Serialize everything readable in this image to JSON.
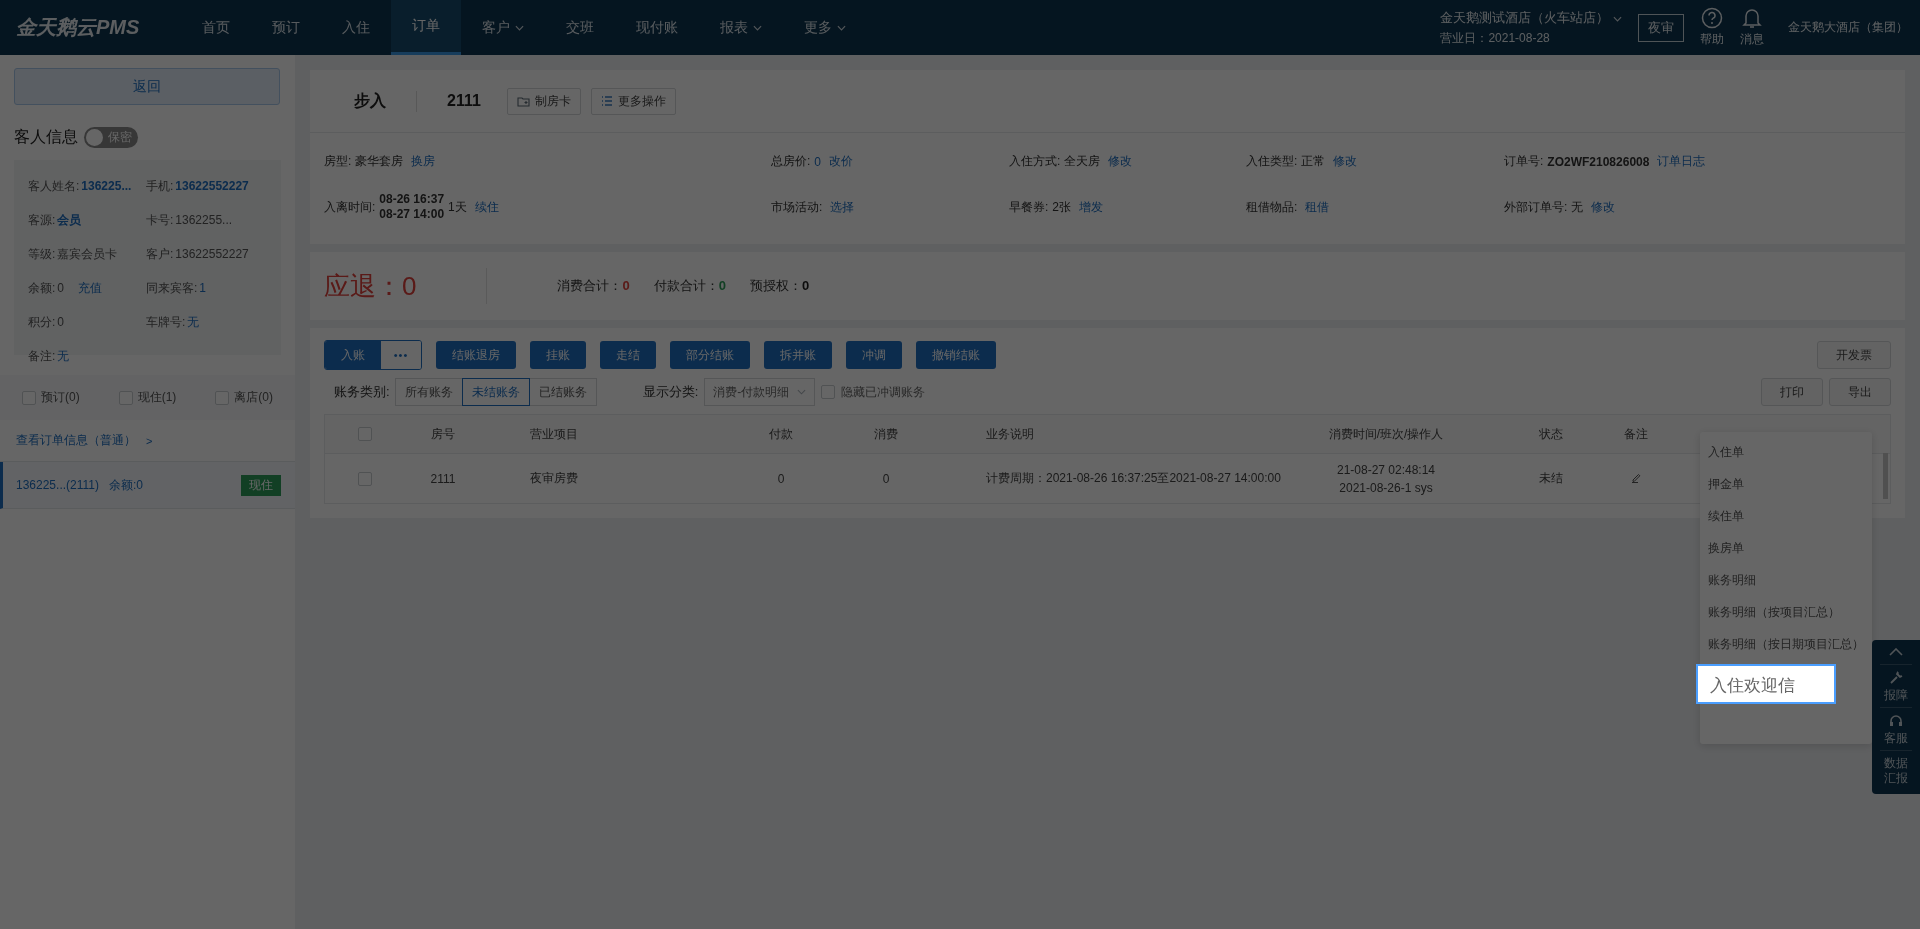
{
  "top_bar": {
    "logo": "金天鹅云PMS",
    "nav": [
      {
        "label": "首页",
        "selected": false,
        "dropdown": false
      },
      {
        "label": "预订",
        "selected": false,
        "dropdown": false
      },
      {
        "label": "入住",
        "selected": false,
        "dropdown": false
      },
      {
        "label": "订单",
        "selected": true,
        "dropdown": false
      },
      {
        "label": "客户",
        "selected": false,
        "dropdown": true
      },
      {
        "label": "交班",
        "selected": false,
        "dropdown": false
      },
      {
        "label": "现付账",
        "selected": false,
        "dropdown": false
      },
      {
        "label": "报表",
        "selected": false,
        "dropdown": true
      },
      {
        "label": "更多",
        "selected": false,
        "dropdown": true
      }
    ],
    "hotel": "金天鹅测试酒店（火车站店）",
    "business_date": "营业日：2021-08-28",
    "night_audit_button": "夜审",
    "help": "帮助",
    "messages": "消息",
    "group": "金天鹅大酒店（集团）"
  },
  "sidebar": {
    "back_button": "返回",
    "guest_info_title": "客人信息",
    "privacy_toggle": {
      "label": "保密",
      "on": false
    },
    "guest_fields": [
      {
        "label": "客人姓名:",
        "value": "136225...",
        "kind": "strong"
      },
      {
        "label": "手机:",
        "value": "13622552227",
        "kind": "strong"
      },
      {
        "label": "客源:",
        "value": "会员",
        "kind": "strong"
      },
      {
        "label": "卡号:",
        "value": "1362255...",
        "kind": "plain"
      },
      {
        "label": "等级:",
        "value": "嘉宾会员卡",
        "kind": "plain"
      },
      {
        "label": "客户:",
        "value": "13622552227",
        "kind": "plain"
      },
      {
        "label": "余额:",
        "value": "0",
        "kind": "plain",
        "action": "充值"
      },
      {
        "label": "同来宾客:",
        "value": "1",
        "kind": "link"
      },
      {
        "label": "积分:",
        "value": "0",
        "kind": "plain"
      },
      {
        "label": "车牌号:",
        "value": "无",
        "kind": "link"
      },
      {
        "label": "备注:",
        "value": "无",
        "kind": "link"
      }
    ],
    "status_filters": [
      {
        "label": "预订(0)",
        "checked": false
      },
      {
        "label": "现住(1)",
        "checked": false
      },
      {
        "label": "离店(0)",
        "checked": false
      }
    ],
    "order_info_link": "查看订单信息（普通）",
    "order_info_arrow": ">",
    "orders": [
      {
        "text": "136225...(2111)",
        "balance": "余额:0",
        "status": "现住",
        "selected": true
      }
    ]
  },
  "order_header": {
    "guest_type": "步入",
    "room": "2111",
    "buttons": [
      {
        "label": "制房卡",
        "kind": "card"
      },
      {
        "label": "更多操作",
        "kind": "list"
      }
    ]
  },
  "order_details": [
    {
      "label": "房型:",
      "value": "豪华套房",
      "link": false,
      "bold": false,
      "action": "换房"
    },
    {
      "label": "总房价:",
      "value": "0",
      "link": true,
      "bold": false,
      "action": "改价"
    },
    {
      "label": "入住方式:",
      "value": "全天房",
      "link": false,
      "bold": false,
      "action": "修改"
    },
    {
      "label": "入住类型:",
      "value": "正常",
      "link": false,
      "bold": false,
      "action": "修改"
    },
    {
      "label": "订单号:",
      "value": "ZO2WF210826008",
      "link": false,
      "bold": true,
      "action": "订单日志"
    },
    {
      "label": "入离时间:",
      "lines": [
        "08-26 16:37",
        "08-27 14:00"
      ],
      "value": "1天",
      "link": false,
      "bold": false,
      "action": "续住"
    },
    {
      "label": "市场活动:",
      "action": "选择"
    },
    {
      "label": "早餐券:",
      "value": "2张",
      "link": false,
      "bold": false,
      "action": "增发"
    },
    {
      "label": "租借物品:",
      "action": "租借"
    },
    {
      "label": "外部订单号:",
      "value": "无",
      "link": false,
      "bold": false,
      "action": "修改"
    }
  ],
  "summary": {
    "refund_label": "应退：",
    "refund_value": "0",
    "totals": [
      {
        "label": "消费合计：",
        "value": "0",
        "kind": "charge"
      },
      {
        "label": "付款合计：",
        "value": "0",
        "kind": "payment"
      },
      {
        "label": "预授权：",
        "value": "0",
        "kind": "neutral"
      }
    ]
  },
  "actions": {
    "post_button": "入账",
    "more_button": "•••",
    "buttons": [
      "结账退房",
      "挂账",
      "走结",
      "部分结账",
      "拆并账",
      "冲调",
      "撤销结账"
    ],
    "invoice_button": "开发票"
  },
  "filters": {
    "category_label": "账务类别:",
    "categories": [
      {
        "label": "所有账务",
        "selected": false
      },
      {
        "label": "未结账务",
        "selected": true
      },
      {
        "label": "已结账务",
        "selected": false
      }
    ],
    "display_label": "显示分类:",
    "display_select": "消费-付款明细",
    "hide_adjusted": {
      "label": "隐藏已冲调账务",
      "checked": false
    },
    "print_button": "打印",
    "export_button": "导出"
  },
  "table": {
    "header_checked": false,
    "columns": [
      "房号",
      "营业项目",
      "付款",
      "消费",
      "业务说明",
      "消费时间/班次/操作人",
      "状态",
      "备注"
    ],
    "rows": [
      {
        "checked": false,
        "room": "2111",
        "item": "夜审房费",
        "payment": "0",
        "charge": "0",
        "description": "计费周期：2021-08-26 16:37:25至2021-08-27 14:00:00",
        "time": "21-08-27 02:48:14",
        "shift": "2021-08-26-1 sys",
        "status": "未结"
      }
    ]
  },
  "print_menu": [
    {
      "label": "入住单",
      "selected": false
    },
    {
      "label": "押金单",
      "selected": false
    },
    {
      "label": "续住单",
      "selected": false
    },
    {
      "label": "换房单",
      "selected": false
    },
    {
      "label": "账务明细",
      "selected": false
    },
    {
      "label": "账务明细（按项目汇总）",
      "selected": false
    },
    {
      "label": "账务明细（按日期项目汇总）",
      "selected": false
    },
    {
      "label": "入住欢迎信",
      "selected": true
    }
  ],
  "float_toolbar": [
    {
      "label": "报障",
      "kind": "wrench"
    },
    {
      "label": "客服",
      "kind": "headset"
    },
    {
      "label": "数据汇报",
      "kind": "plain"
    }
  ]
}
